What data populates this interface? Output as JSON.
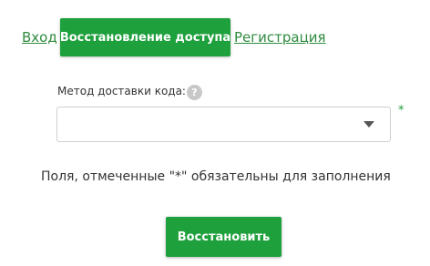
{
  "tabs": {
    "login": "Вход",
    "recovery": "Восстановление доступа",
    "register": "Регистрация"
  },
  "form": {
    "delivery_label": "Метод доставки кода:",
    "help_icon": "question-icon",
    "help_glyph": "?",
    "delivery_value": "",
    "required_mark": "*"
  },
  "note": "Поля, отмеченные \"*\" обязательны для заполнения",
  "submit_label": "Восстановить",
  "colors": {
    "accent": "#1ea03c",
    "link": "#2e8b3f"
  }
}
